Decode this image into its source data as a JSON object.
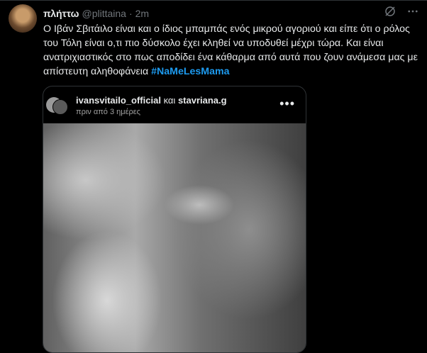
{
  "tweet": {
    "display_name": "πλήττω",
    "handle": "@plittaina",
    "separator": "·",
    "time": "2m",
    "text": "Ο Ιβάν Σβιτάιλο είναι και ο ίδιος μπαμπάς ενός μικρού αγοριού και είπε ότι ο ρόλος του Τόλη είναι ο,τι πιο δύσκολο έχει κληθεί να υποδυθεί μέχρι τώρα. Και είναι ανατριχιαστικός στο πως αποδίδει ένα κάθαρμα από αυτά που ζουν ανάμεσα μας με απίστευτη αληθοφάνεια ",
    "hashtag": "#NaMeLesMama",
    "icons": {
      "grok": "grok-icon",
      "more": "more-icon"
    }
  },
  "embed": {
    "user1": "ivansvitailo_official",
    "connector": "και",
    "user2": "stavriana.g",
    "time": "πριν από 3 ημέρες",
    "more": "•••"
  }
}
